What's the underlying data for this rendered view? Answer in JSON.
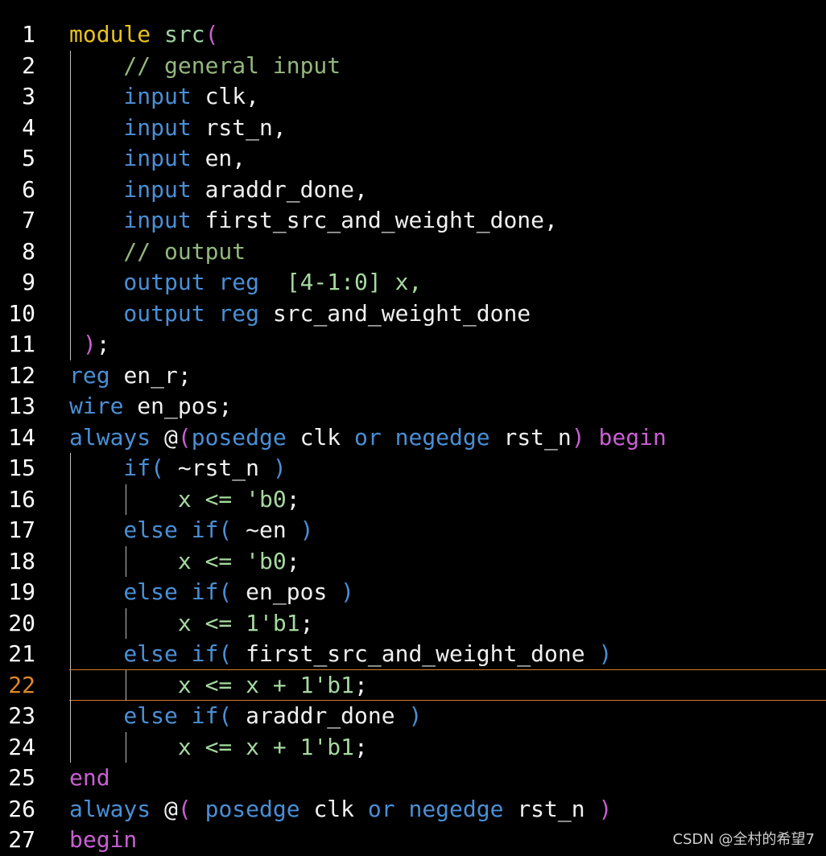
{
  "editor": {
    "active_line": 22,
    "lines": [
      {
        "n": "1",
        "tokens": [
          {
            "t": "module ",
            "c": "kw-yellow"
          },
          {
            "t": "src",
            "c": "id-green"
          },
          {
            "t": "(",
            "c": "kw-purple"
          }
        ]
      },
      {
        "n": "2",
        "tokens": [
          {
            "t": "    // general input",
            "c": "comment"
          }
        ]
      },
      {
        "n": "3",
        "tokens": [
          {
            "t": "    input ",
            "c": "kw-blue"
          },
          {
            "t": "clk,",
            "c": "plain"
          }
        ]
      },
      {
        "n": "4",
        "tokens": [
          {
            "t": "    input ",
            "c": "kw-blue"
          },
          {
            "t": "rst_n,",
            "c": "plain"
          }
        ]
      },
      {
        "n": "5",
        "tokens": [
          {
            "t": "    input ",
            "c": "kw-blue"
          },
          {
            "t": "en,",
            "c": "plain"
          }
        ]
      },
      {
        "n": "6",
        "tokens": [
          {
            "t": "    input ",
            "c": "kw-blue"
          },
          {
            "t": "araddr_done,",
            "c": "plain"
          }
        ]
      },
      {
        "n": "7",
        "tokens": [
          {
            "t": "    input ",
            "c": "kw-blue"
          },
          {
            "t": "first_src_and_weight_done,",
            "c": "plain"
          }
        ]
      },
      {
        "n": "8",
        "tokens": [
          {
            "t": "    // output",
            "c": "comment"
          }
        ]
      },
      {
        "n": "9",
        "tokens": [
          {
            "t": "    output reg  ",
            "c": "kw-blue"
          },
          {
            "t": "[4-1:0] x,",
            "c": "num"
          }
        ]
      },
      {
        "n": "10",
        "tokens": [
          {
            "t": "    output reg ",
            "c": "kw-blue"
          },
          {
            "t": "src_and_weight_done",
            "c": "plain"
          }
        ]
      },
      {
        "n": "11",
        "tokens": [
          {
            "t": " )",
            "c": "kw-purple"
          },
          {
            "t": ";",
            "c": "plain"
          }
        ]
      },
      {
        "n": "12",
        "tokens": [
          {
            "t": "reg ",
            "c": "kw-blue"
          },
          {
            "t": "en_r;",
            "c": "plain"
          }
        ]
      },
      {
        "n": "13",
        "tokens": [
          {
            "t": "wire ",
            "c": "kw-blue"
          },
          {
            "t": "en_pos;",
            "c": "plain"
          }
        ]
      },
      {
        "n": "14",
        "tokens": [
          {
            "t": "always ",
            "c": "kw-blue"
          },
          {
            "t": "@",
            "c": "plain"
          },
          {
            "t": "(",
            "c": "kw-purple"
          },
          {
            "t": "posedge ",
            "c": "kw-blue"
          },
          {
            "t": "clk ",
            "c": "plain"
          },
          {
            "t": "or ",
            "c": "kw-blue"
          },
          {
            "t": "negedge ",
            "c": "kw-blue"
          },
          {
            "t": "rst_n",
            "c": "plain"
          },
          {
            "t": ") ",
            "c": "kw-purple"
          },
          {
            "t": "begin",
            "c": "kw-purple"
          }
        ]
      },
      {
        "n": "15",
        "tokens": [
          {
            "t": "    if( ",
            "c": "kw-blue"
          },
          {
            "t": "~rst_n ",
            "c": "plain"
          },
          {
            "t": ")",
            "c": "kw-blue"
          }
        ]
      },
      {
        "n": "16",
        "tokens": [
          {
            "t": "        x <= ",
            "c": "num"
          },
          {
            "t": "'b0",
            "c": "num"
          },
          {
            "t": ";",
            "c": "plain"
          }
        ]
      },
      {
        "n": "17",
        "tokens": [
          {
            "t": "    else if( ",
            "c": "kw-blue"
          },
          {
            "t": "~en ",
            "c": "plain"
          },
          {
            "t": ")",
            "c": "kw-blue"
          }
        ]
      },
      {
        "n": "18",
        "tokens": [
          {
            "t": "        x <= ",
            "c": "num"
          },
          {
            "t": "'b0",
            "c": "num"
          },
          {
            "t": ";",
            "c": "plain"
          }
        ]
      },
      {
        "n": "19",
        "tokens": [
          {
            "t": "    else if( ",
            "c": "kw-blue"
          },
          {
            "t": "en_pos ",
            "c": "plain"
          },
          {
            "t": ")",
            "c": "kw-blue"
          }
        ]
      },
      {
        "n": "20",
        "tokens": [
          {
            "t": "        x <= ",
            "c": "num"
          },
          {
            "t": "1'b1",
            "c": "num"
          },
          {
            "t": ";",
            "c": "plain"
          }
        ]
      },
      {
        "n": "21",
        "tokens": [
          {
            "t": "    else if( ",
            "c": "kw-blue"
          },
          {
            "t": "first_src_and_weight_done ",
            "c": "plain"
          },
          {
            "t": ")",
            "c": "kw-blue"
          }
        ]
      },
      {
        "n": "22",
        "tokens": [
          {
            "t": "        x <= x + ",
            "c": "num"
          },
          {
            "t": "1'b1",
            "c": "num"
          },
          {
            "t": ";",
            "c": "plain"
          }
        ]
      },
      {
        "n": "23",
        "tokens": [
          {
            "t": "    else if( ",
            "c": "kw-blue"
          },
          {
            "t": "araddr_done ",
            "c": "plain"
          },
          {
            "t": ")",
            "c": "kw-blue"
          }
        ]
      },
      {
        "n": "24",
        "tokens": [
          {
            "t": "        x <= x + ",
            "c": "num"
          },
          {
            "t": "1'b1",
            "c": "num"
          },
          {
            "t": ";",
            "c": "plain"
          }
        ]
      },
      {
        "n": "25",
        "tokens": [
          {
            "t": "end",
            "c": "kw-purple"
          }
        ]
      },
      {
        "n": "26",
        "tokens": [
          {
            "t": "always ",
            "c": "kw-blue"
          },
          {
            "t": "@",
            "c": "plain"
          },
          {
            "t": "( ",
            "c": "kw-purple"
          },
          {
            "t": "posedge ",
            "c": "kw-blue"
          },
          {
            "t": "clk ",
            "c": "plain"
          },
          {
            "t": "or ",
            "c": "kw-blue"
          },
          {
            "t": "negedge ",
            "c": "kw-blue"
          },
          {
            "t": "rst_n ",
            "c": "plain"
          },
          {
            "t": ")",
            "c": "kw-purple"
          }
        ]
      },
      {
        "n": "27",
        "tokens": [
          {
            "t": "begin",
            "c": "kw-purple"
          }
        ]
      }
    ]
  },
  "watermark": "CSDN @全村的希望7",
  "colors": {
    "background": "#000000",
    "keyword_yellow": "#e8c21e",
    "keyword_blue": "#4a8fd6",
    "keyword_purple": "#c95fd3",
    "comment": "#94b77e",
    "number": "#a6d9a0",
    "active_line_number": "#e0872a"
  }
}
